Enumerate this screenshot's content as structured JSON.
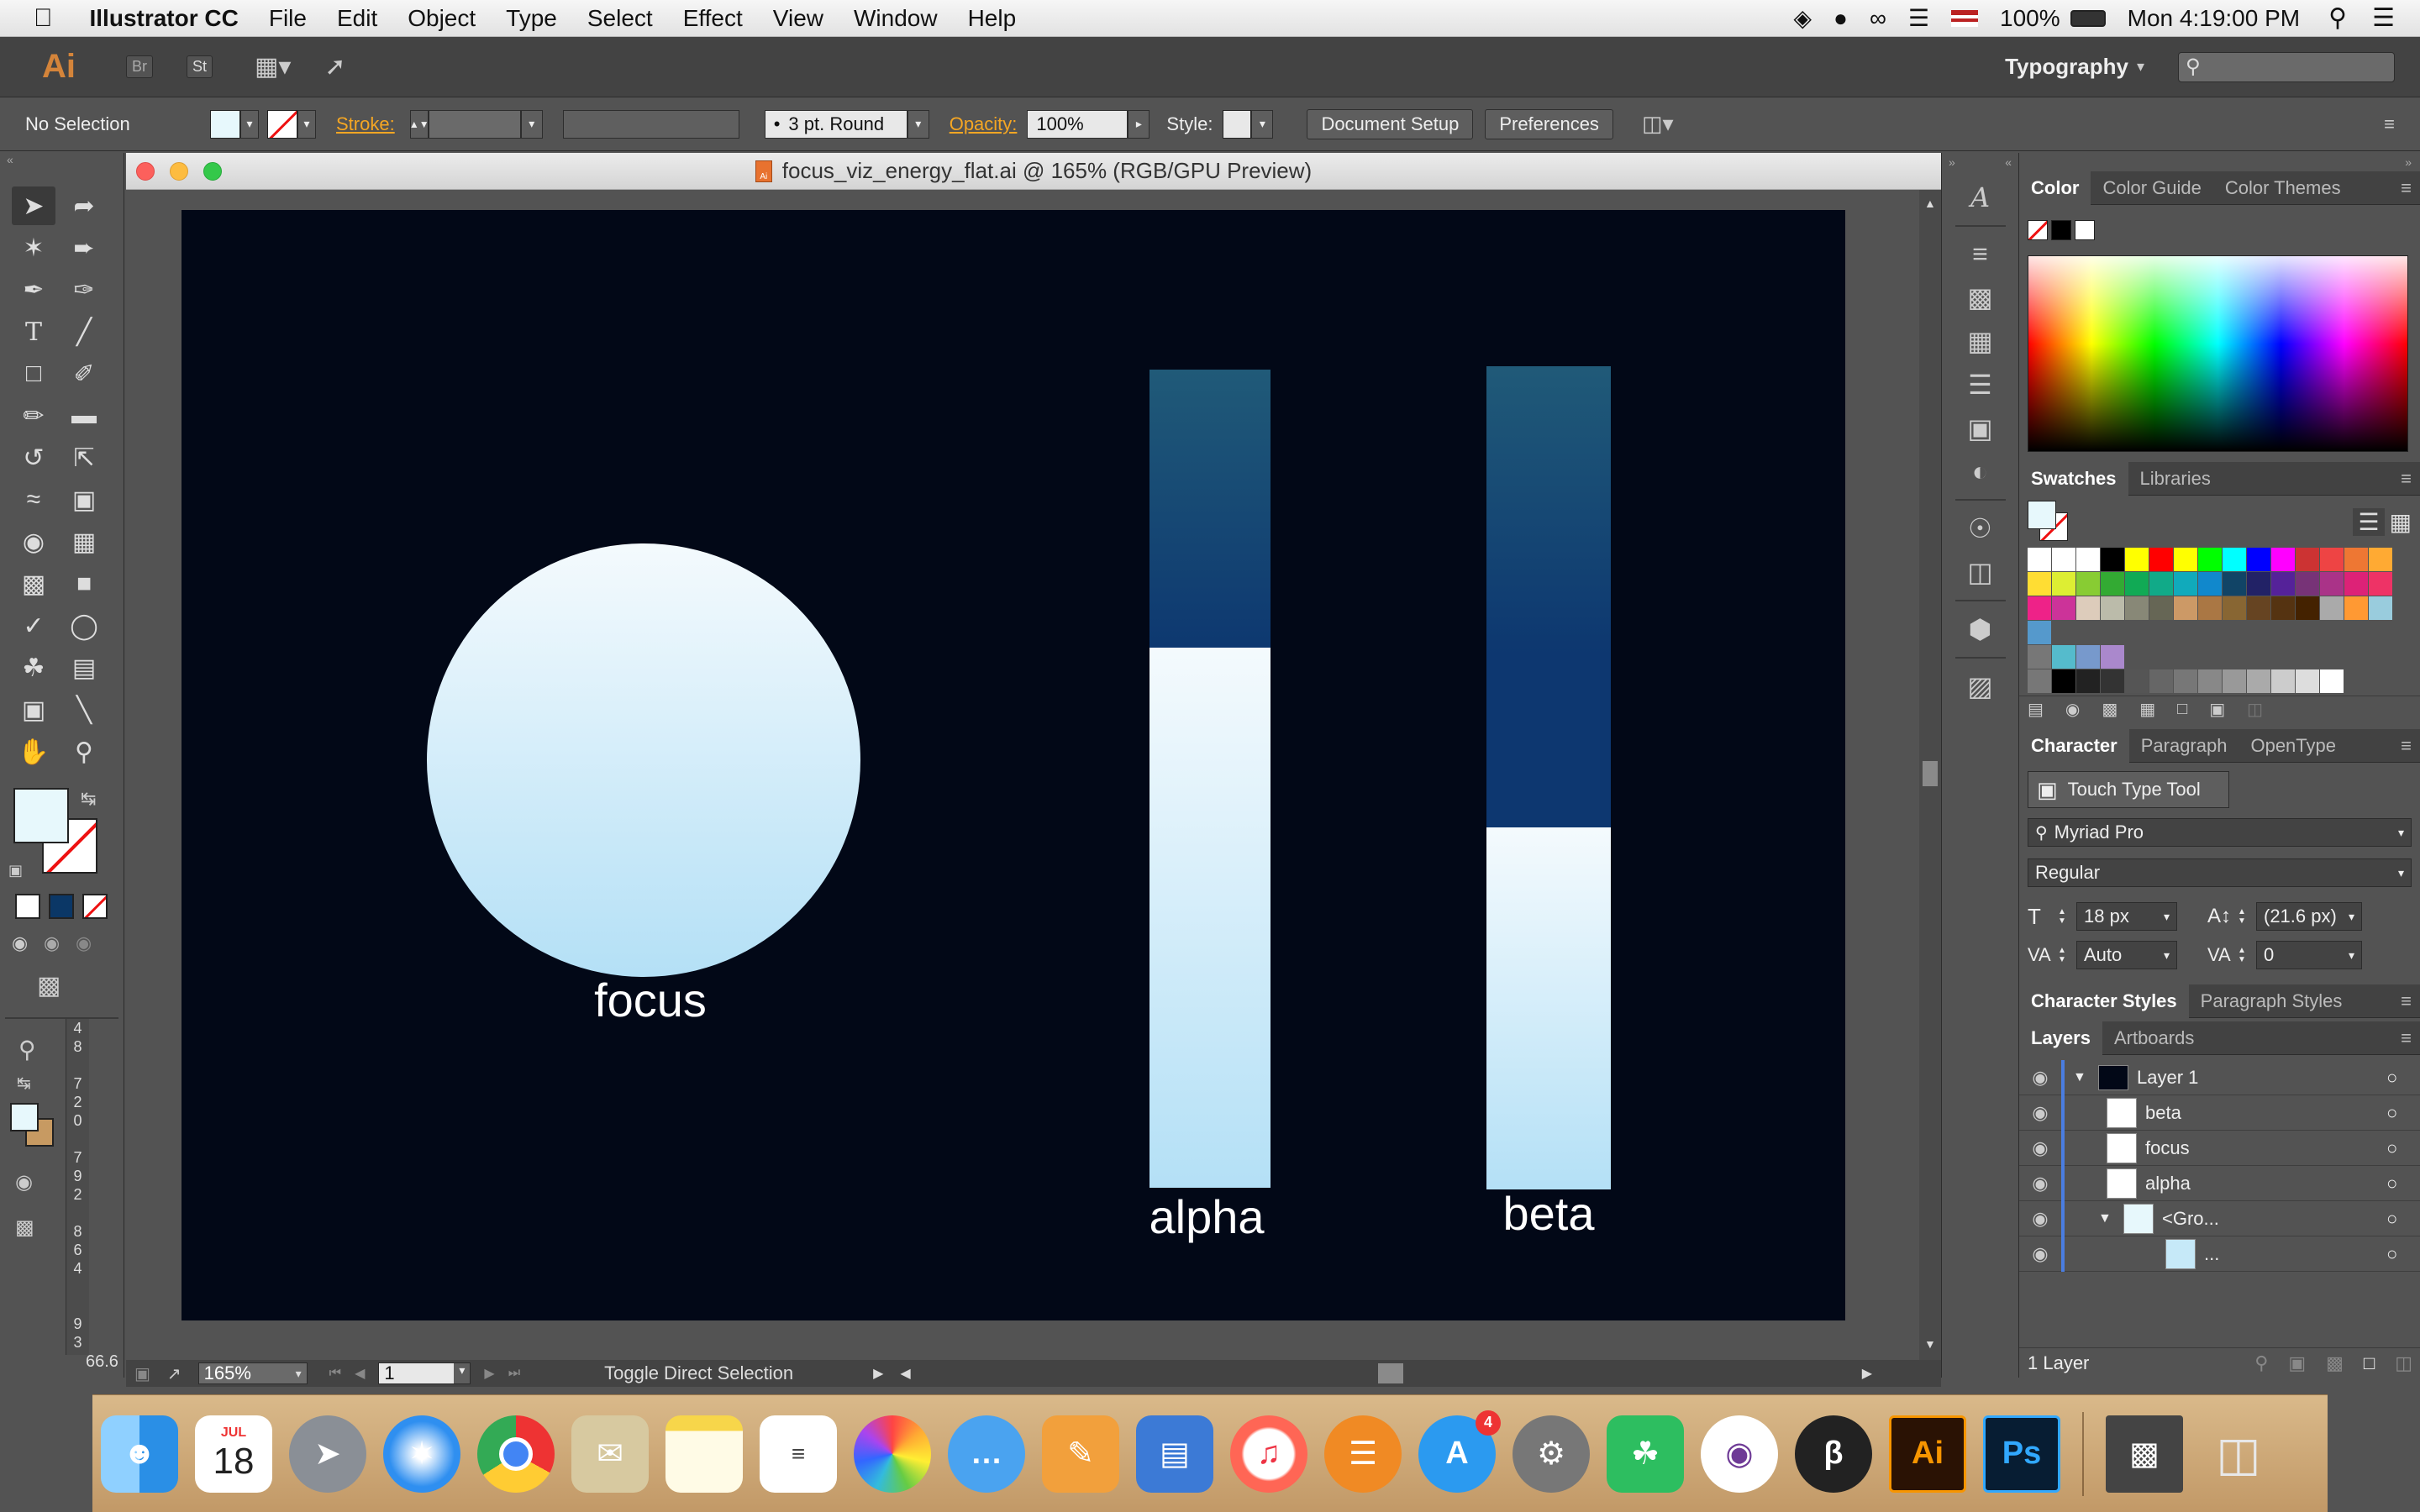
{
  "menubar": {
    "app_name": "Illustrator CC",
    "menus": [
      "File",
      "Edit",
      "Object",
      "Type",
      "Select",
      "Effect",
      "View",
      "Window",
      "Help"
    ],
    "battery": "100%",
    "clock": "Mon 4:19:00 PM"
  },
  "appbar": {
    "ai_logo": "Ai",
    "br_label": "Br",
    "st_label": "St",
    "workspace": "Typography"
  },
  "controlbar": {
    "selection": "No Selection",
    "stroke_label": "Stroke:",
    "brush": "3 pt. Round",
    "opacity_label": "Opacity:",
    "opacity_value": "100%",
    "style_label": "Style:",
    "document_setup": "Document Setup",
    "preferences": "Preferences"
  },
  "document": {
    "title": "focus_viz_energy_flat.ai @ 165% (RGB/GPU Preview)",
    "zoom": "165%",
    "page": "1",
    "status": "Toggle Direct Selection",
    "ruler_value": "66.6"
  },
  "artwork": {
    "focus_label": "focus",
    "alpha_label": "alpha",
    "beta_label": "beta",
    "alpha_fill_fraction": 0.66,
    "beta_fill_fraction": 0.44,
    "colors": {
      "background": "#020817",
      "bar_top": "#205a78",
      "bar_dark": "#0d3770",
      "light_top": "#f4fafd",
      "light_bottom": "#b4e0f6"
    }
  },
  "color_panel": {
    "tabs": [
      "Color",
      "Color Guide",
      "Color Themes"
    ]
  },
  "swatches_panel": {
    "tabs": [
      "Swatches",
      "Libraries"
    ]
  },
  "character_panel": {
    "tabs": [
      "Character",
      "Paragraph",
      "OpenType"
    ],
    "touch_type": "Touch Type Tool",
    "font": "Myriad Pro",
    "style": "Regular",
    "size": "18 px",
    "leading": "(21.6 px)",
    "kerning": "Auto",
    "tracking": "0"
  },
  "styles_tabs": [
    "Character Styles",
    "Paragraph Styles"
  ],
  "layers_panel": {
    "tabs": [
      "Layers",
      "Artboards"
    ],
    "items": [
      "Layer 1",
      "beta",
      "focus",
      "alpha",
      "<Gro...",
      "..."
    ],
    "footer": "1 Layer"
  },
  "dock": {
    "calendar_month": "JUL",
    "calendar_day": "18",
    "appstore_badge": "4",
    "ai_label": "Ai",
    "ps_label": "Ps"
  }
}
